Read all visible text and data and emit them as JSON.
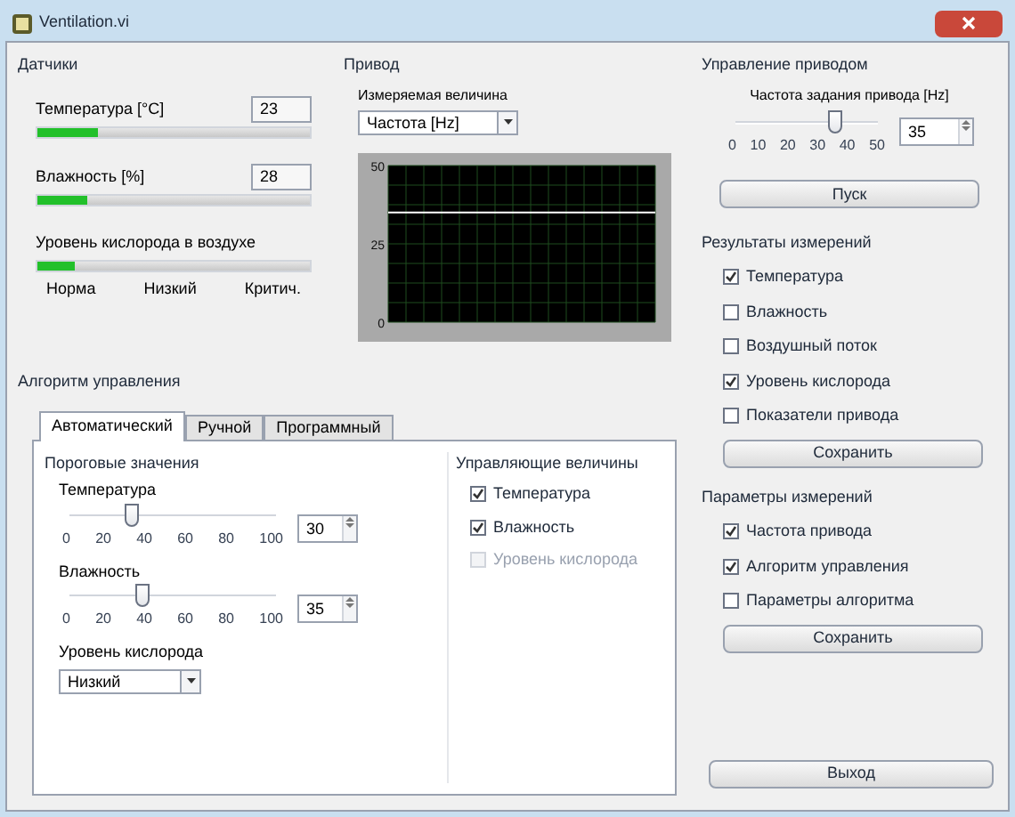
{
  "window": {
    "title": "Ventilation.vi"
  },
  "sensors": {
    "title": "Датчики",
    "gauges": [
      {
        "label": "Температура [°C]",
        "value": "23",
        "level": 0.22
      },
      {
        "label": "Влажность [%]",
        "value": "28",
        "level": 0.18
      }
    ],
    "oxygen": {
      "label": "Уровень кислорода в воздухе",
      "level": 0.14,
      "scale": [
        "Норма",
        "Низкий",
        "Критич."
      ]
    }
  },
  "drive": {
    "title": "Привод",
    "measured_label": "Измеряемая величина",
    "measured_value": "Частота [Hz]",
    "chart_data": {
      "type": "line",
      "grid": true,
      "ylim": [
        0,
        50
      ],
      "yticks": [
        0,
        25,
        50
      ],
      "series": [
        {
          "color": "#ffffff",
          "values": [
            35,
            35,
            35,
            35,
            35,
            35,
            35,
            35,
            35,
            35,
            35,
            35,
            35,
            35,
            35,
            35,
            35,
            35,
            35,
            35
          ]
        }
      ]
    }
  },
  "algorithm": {
    "title": "Алгоритм управления",
    "tabs": [
      {
        "label": "Автоматический",
        "selected": true
      },
      {
        "label": "Ручной",
        "selected": false
      },
      {
        "label": "Программный",
        "selected": false
      }
    ],
    "thresholds": {
      "title": "Пороговые значения",
      "sliders": [
        {
          "label": "Температура",
          "level": 0.3,
          "value": "30",
          "ticks": [
            "0",
            "20",
            "40",
            "60",
            "80",
            "100"
          ]
        },
        {
          "label": "Влажность",
          "level": 0.35,
          "value": "35",
          "ticks": [
            "0",
            "20",
            "40",
            "60",
            "80",
            "100"
          ]
        }
      ],
      "oxygen_label": "Уровень кислорода",
      "oxygen_value": "Низкий"
    },
    "controlled": {
      "title": "Управляющие величины",
      "items": [
        {
          "label": "Температура",
          "checked": true,
          "disabled": false
        },
        {
          "label": "Влажность",
          "checked": true,
          "disabled": false
        },
        {
          "label": "Уровень кислорода",
          "checked": false,
          "disabled": true
        }
      ]
    }
  },
  "drive_control": {
    "title": "Управление приводом",
    "slider_label": "Частота задания привода [Hz]",
    "level": 0.7,
    "ticks": [
      "0",
      "10",
      "20",
      "30",
      "40",
      "50"
    ],
    "value": "35",
    "button": "Пуск"
  },
  "results": {
    "title": "Результаты измерений",
    "items": [
      {
        "label": "Температура",
        "checked": true
      },
      {
        "label": "Влажность",
        "checked": false
      },
      {
        "label": "Воздушный поток",
        "checked": false
      },
      {
        "label": "Уровень кислорода",
        "checked": true
      },
      {
        "label": "Показатели привода",
        "checked": false
      }
    ],
    "button": "Сохранить"
  },
  "params": {
    "title": "Параметры измерений",
    "items": [
      {
        "label": "Частота привода",
        "checked": true
      },
      {
        "label": "Алгоритм управления",
        "checked": true
      },
      {
        "label": "Параметры алгоритма",
        "checked": false
      }
    ],
    "button": "Сохранить"
  },
  "exit_button": "Выход"
}
